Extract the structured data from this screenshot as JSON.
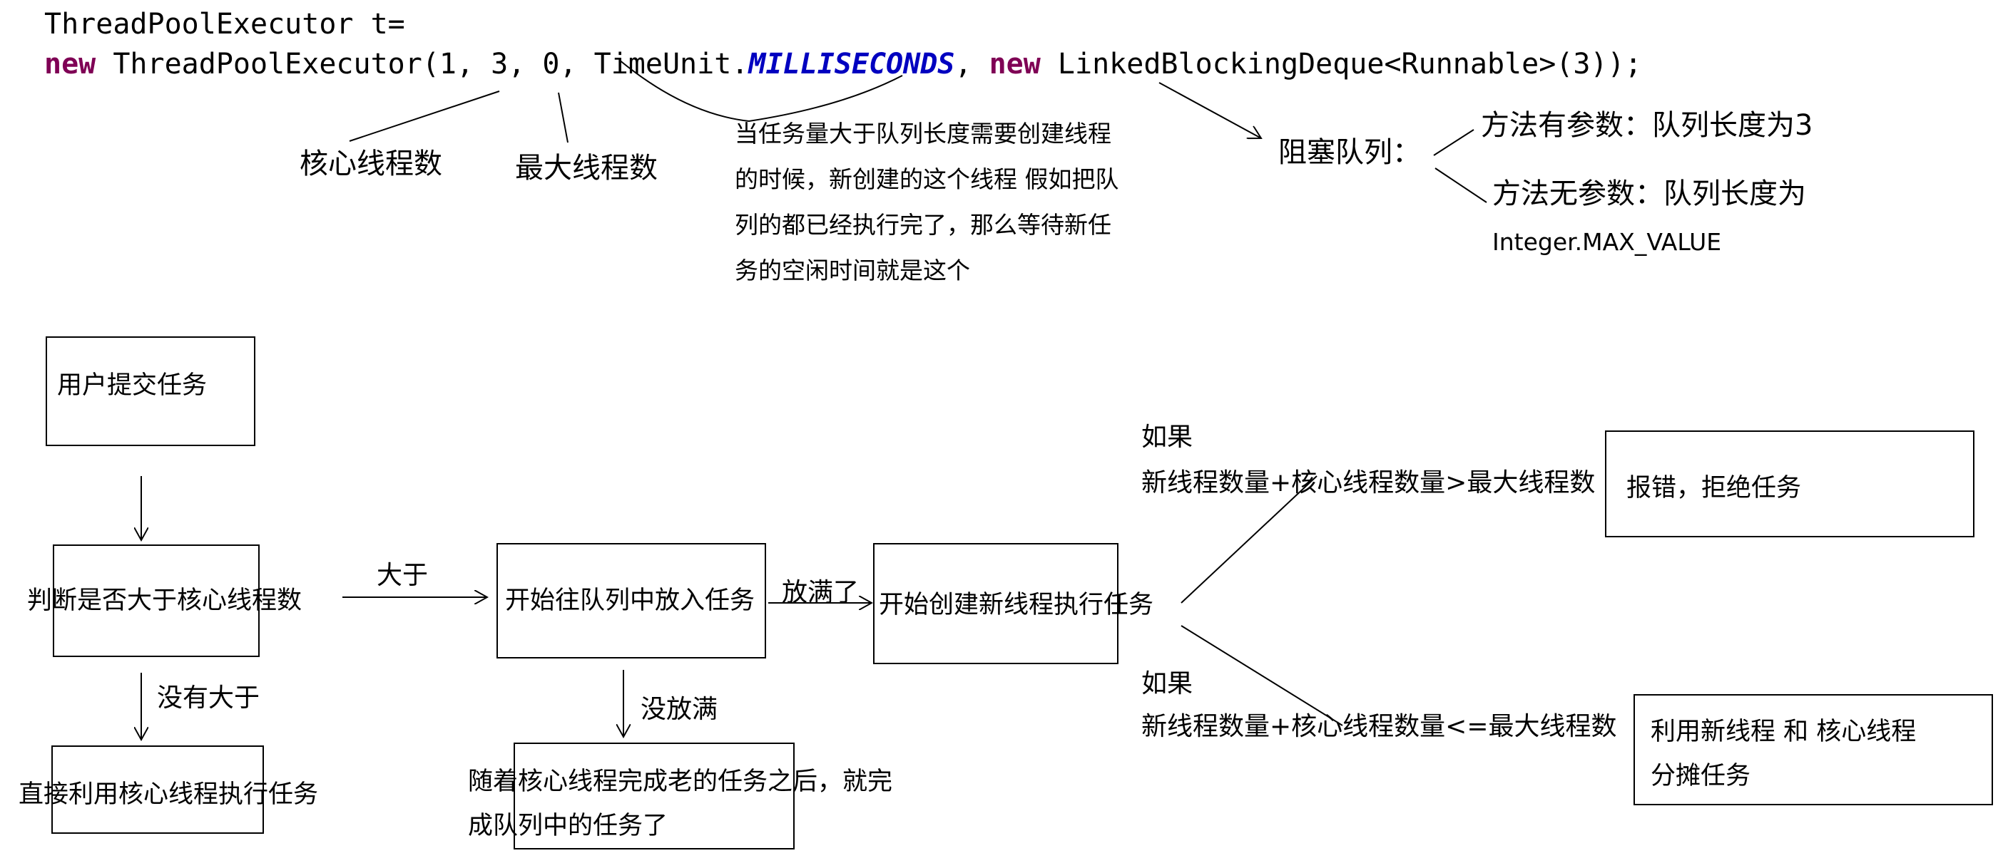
{
  "code": {
    "line1_class": "ThreadPoolExecutor",
    "line1_var": "t=",
    "line2_new1": "new",
    "line2_part1": "ThreadPoolExecutor(1, 3, 0, TimeUnit.",
    "line2_const": "MILLISECONDS",
    "line2_part2": ",",
    "line2_new2": "new",
    "line2_part3": "LinkedBlockingDeque<Runnable>(3));"
  },
  "annotations": {
    "core_threads": "核心线程数",
    "max_threads": "最大线程数",
    "idle_lines": [
      "当任务量大于队列长度需要创建线程",
      "的时候，新创建的这个线程 假如把队",
      "列的都已经执行完了，那么等待新任",
      "务的空闲时间就是这个"
    ],
    "blocking_queue": "阻塞队列：",
    "with_param": "方法有参数：队列长度为3",
    "without_param": "方法无参数：队列长度为",
    "max_value": "Integer.MAX_VALUE"
  },
  "flow": {
    "user_submit": "用户提交任务",
    "check_core": "判断是否大于核心线程数",
    "greater": "大于",
    "put_queue": "开始往队列中放入任务",
    "queue_full": "放满了",
    "create_thread": "开始创建新线程执行任务",
    "not_greater": "没有大于",
    "use_core": "直接利用核心线程执行任务",
    "not_full": "没放满",
    "after_core_lines": [
      "随着核心线程完成老的任务之后，就完",
      "成队列中的任务了"
    ],
    "if1": "如果",
    "cond1": "新线程数量+核心线程数量>最大线程数",
    "reject": "报错，拒绝任务",
    "if2": "如果",
    "cond2": "新线程数量+核心线程数量<=最大线程数",
    "share_lines": [
      "利用新线程 和 核心线程",
      "分摊任务"
    ]
  }
}
